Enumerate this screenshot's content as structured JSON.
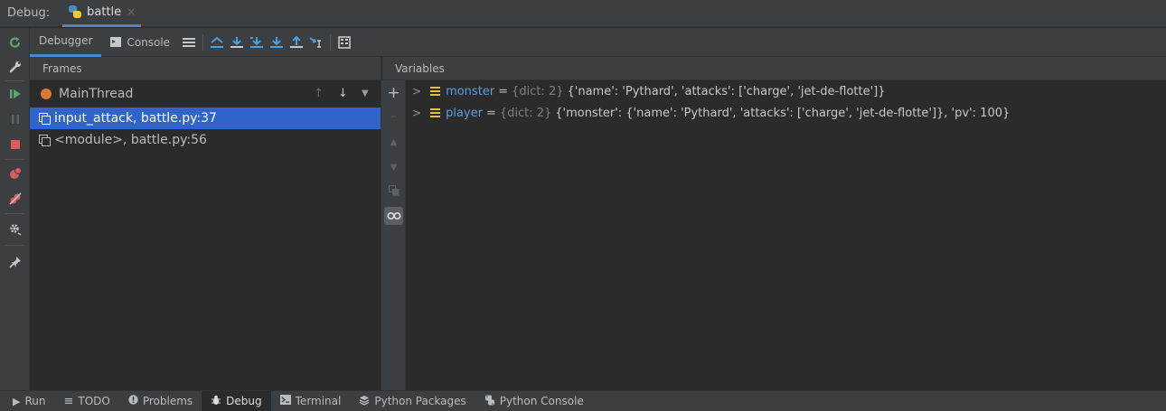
{
  "window": {
    "title": "Debug:",
    "tab_label": "battle",
    "tab_close": "×"
  },
  "toolbar": {
    "debugger_tab": "Debugger",
    "console_tab": "Console"
  },
  "frames": {
    "header": "Frames",
    "thread": "MainThread",
    "items": [
      {
        "label": "input_attack, battle.py:37"
      },
      {
        "label": "<module>, battle.py:56"
      }
    ]
  },
  "variables": {
    "header": "Variables",
    "items": [
      {
        "name": "monster",
        "eq": "=",
        "type": "{dict: 2}",
        "value": "{'name': 'Pythard', 'attacks': ['charge', 'jet-de-flotte']}"
      },
      {
        "name": "player",
        "eq": "=",
        "type": "{dict: 2}",
        "value": "{'monster': {'name': 'Pythard', 'attacks': ['charge', 'jet-de-flotte']}, 'pv': 100}"
      }
    ]
  },
  "bottom_tabs": [
    {
      "label": "Run",
      "icon": "play-icon"
    },
    {
      "label": "TODO",
      "icon": "list-icon"
    },
    {
      "label": "Problems",
      "icon": "problems-icon"
    },
    {
      "label": "Debug",
      "icon": "bug-icon"
    },
    {
      "label": "Terminal",
      "icon": "terminal-icon"
    },
    {
      "label": "Python Packages",
      "icon": "packages-icon"
    },
    {
      "label": "Python Console",
      "icon": "python-icon"
    }
  ],
  "colors": {
    "accent": "#4a88c7",
    "selection": "#2f65ca",
    "thread_dot": "#d97a36",
    "var_name": "#5c9ede",
    "var_icon": "#e0c04c"
  }
}
